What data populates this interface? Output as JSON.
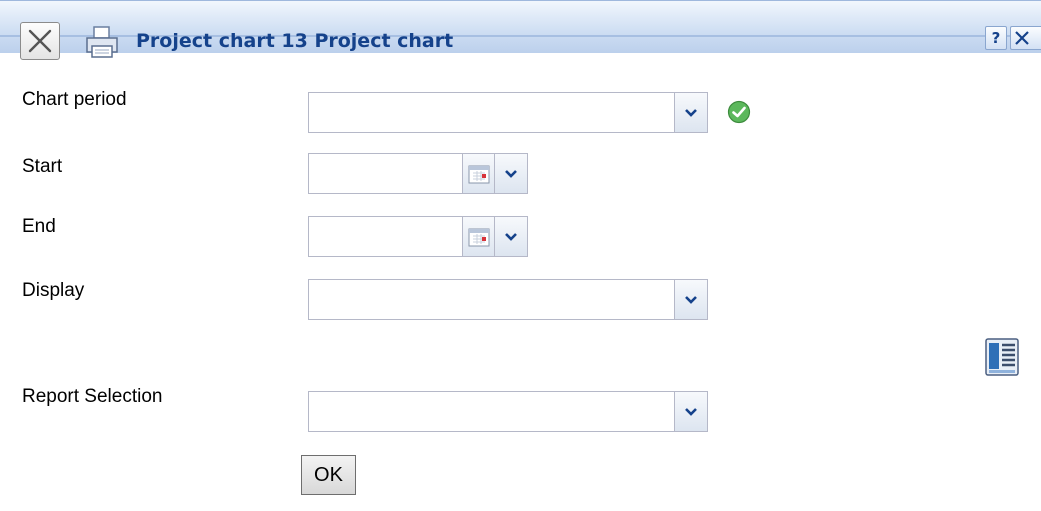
{
  "window": {
    "title": "Project chart 13 Project chart",
    "icons": {
      "close": "close-icon",
      "print": "printer-icon",
      "help": "help-icon",
      "close_small": "close-icon"
    },
    "help_glyph": "?"
  },
  "form": {
    "chart_period": {
      "label": "Chart period",
      "value": "",
      "status_icon": "check-valid-icon"
    },
    "start": {
      "label": "Start",
      "value": ""
    },
    "end": {
      "label": "End",
      "value": ""
    },
    "display": {
      "label": "Display",
      "value": ""
    },
    "report_selection": {
      "label": "Report Selection",
      "value": ""
    },
    "report_icon": "report-list-icon",
    "ok_label": "OK"
  },
  "colors": {
    "title_text": "#15428b",
    "titlebar_bg": "#cddcf2",
    "field_border": "#b5b8c8",
    "valid_green": "#5cb85c"
  }
}
